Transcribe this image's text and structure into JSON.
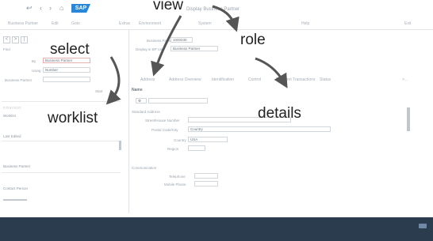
{
  "titlebar": {
    "logo": "SAP",
    "title": "Display Business Partner",
    "icons": [
      "back-icon",
      "forward-icon",
      "home-icon"
    ]
  },
  "menubar": {
    "items": [
      "Business Partner",
      "Edit",
      "Goto",
      "Extras",
      "Environment",
      "System",
      "Help"
    ],
    "right": "Exit"
  },
  "left": {
    "nav_buttons": [
      "<",
      ">",
      "|"
    ],
    "find_label": "Find",
    "fields": [
      {
        "label": "By",
        "value": "Business Partner"
      },
      {
        "label": "Using",
        "value": "Number"
      },
      {
        "label": "Business Partner",
        "value": ""
      }
    ],
    "start_button": "Start",
    "worklist_label": "Worklist",
    "worklist_rows": [
      "Last Edited",
      "Business Partner",
      "Customer",
      "Contact Person"
    ]
  },
  "right": {
    "bp_label": "Business Partner",
    "bp_value": "1000230",
    "role_label": "Display in BP role",
    "role_value": "Business Partner",
    "tabs": [
      "Address",
      "Address Overview",
      "Identification",
      "Control",
      "Payment Transactions",
      "Status"
    ],
    "section": "Name",
    "subsection": "Standard Address",
    "form_rows": [
      {
        "label": "Street/House Number",
        "value": ""
      },
      {
        "label": "Postal Code/City",
        "value": "Country"
      },
      {
        "label": "Country",
        "value": "USA"
      },
      {
        "label": "Region",
        "value": ""
      }
    ],
    "comm_label": "Communication",
    "comm_rows": [
      "Telephone",
      "Mobile Phone"
    ]
  },
  "annotations": {
    "view": "view",
    "select": "select",
    "role": "role",
    "worklist": "worklist",
    "details": "details"
  }
}
